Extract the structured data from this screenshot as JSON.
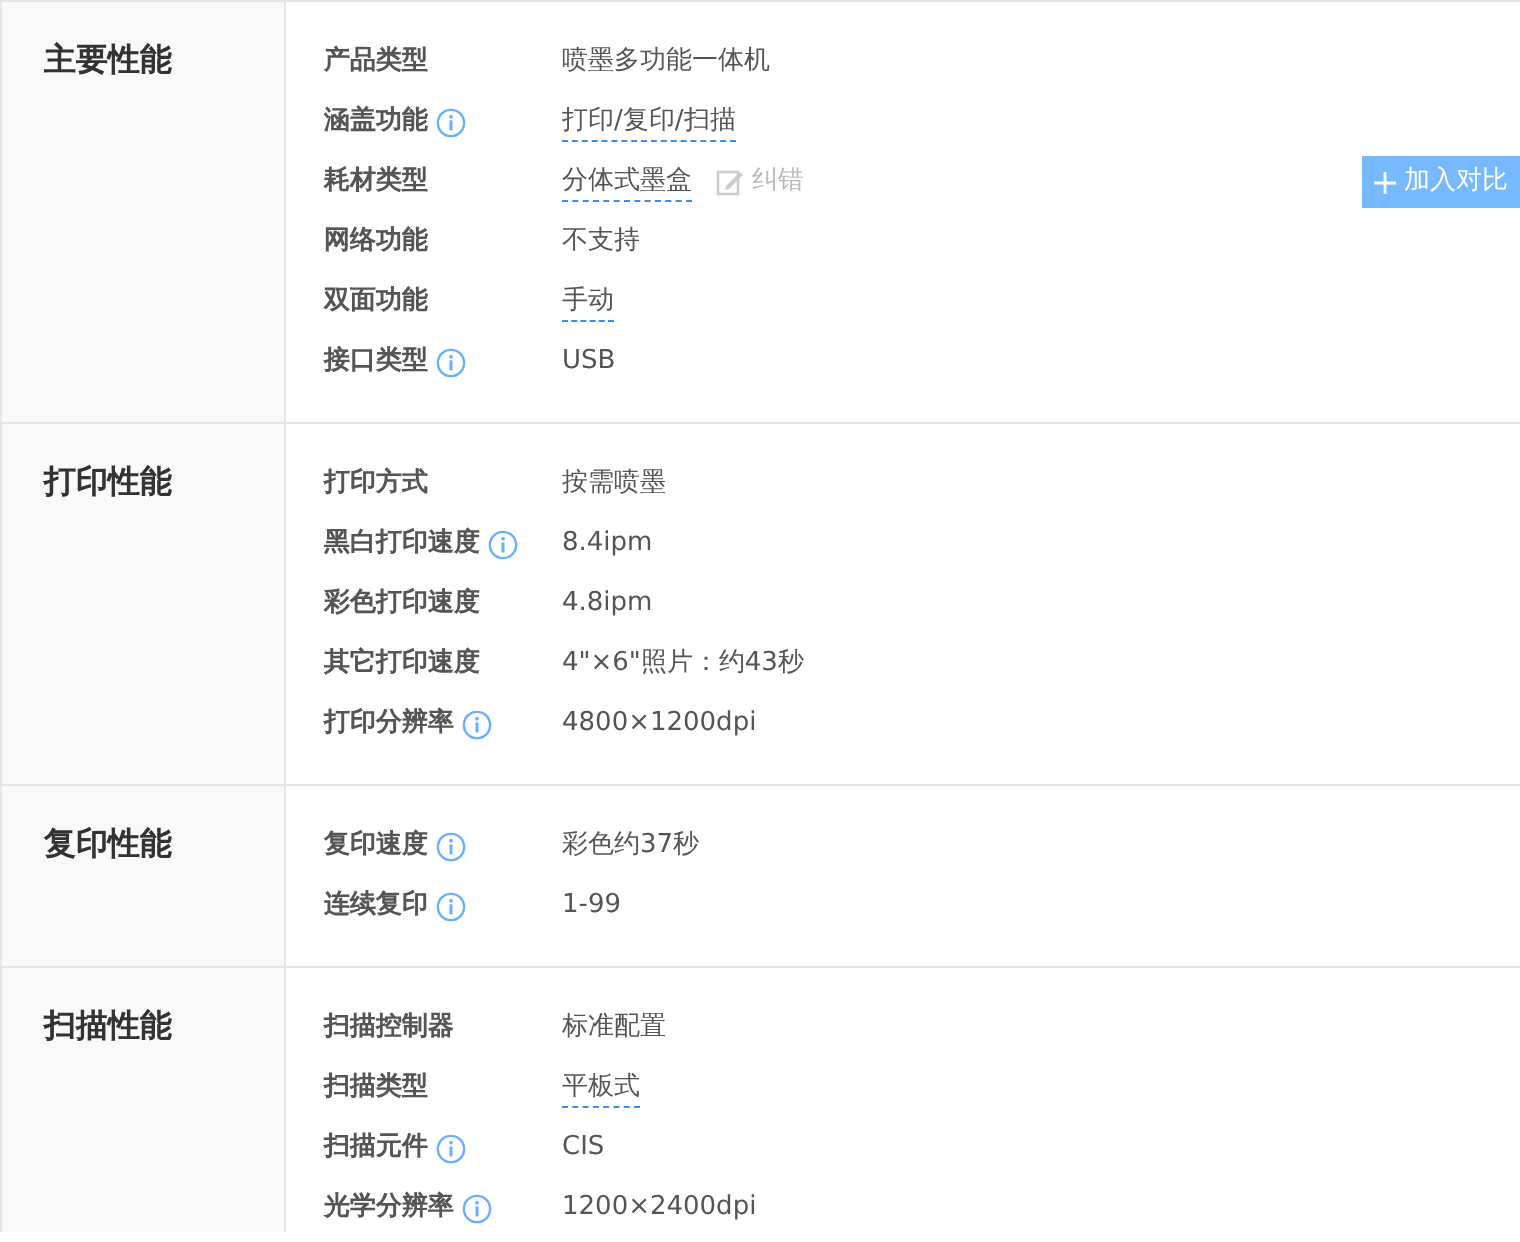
{
  "sections": [
    {
      "title": "主要性能",
      "rows": [
        {
          "label": "产品类型",
          "info": false,
          "value": "喷墨多功能一体机",
          "underlined": false
        },
        {
          "label": "涵盖功能",
          "info": true,
          "value": "打印/复印/扫描",
          "underlined": true
        },
        {
          "label": "耗材类型",
          "info": false,
          "value": "分体式墨盒",
          "underlined": true,
          "correction": "纠错",
          "compare_button": "加入对比"
        },
        {
          "label": "网络功能",
          "info": false,
          "value": "不支持",
          "underlined": false
        },
        {
          "label": "双面功能",
          "info": false,
          "value": "手动",
          "underlined": true
        },
        {
          "label": "接口类型",
          "info": true,
          "value": "USB",
          "underlined": false
        }
      ]
    },
    {
      "title": "打印性能",
      "rows": [
        {
          "label": "打印方式",
          "info": false,
          "value": "按需喷墨",
          "underlined": false
        },
        {
          "label": "黑白打印速度",
          "info": true,
          "value": "8.4ipm",
          "underlined": false
        },
        {
          "label": "彩色打印速度",
          "info": false,
          "value": "4.8ipm",
          "underlined": false
        },
        {
          "label": "其它打印速度",
          "info": false,
          "value": "4\"×6\"照片：约43秒",
          "underlined": false
        },
        {
          "label": "打印分辨率",
          "info": true,
          "value": "4800×1200dpi",
          "underlined": false
        }
      ]
    },
    {
      "title": "复印性能",
      "rows": [
        {
          "label": "复印速度",
          "info": true,
          "value": "彩色约37秒",
          "underlined": false
        },
        {
          "label": "连续复印",
          "info": true,
          "value": "1-99",
          "underlined": false
        }
      ]
    },
    {
      "title": "扫描性能",
      "rows": [
        {
          "label": "扫描控制器",
          "info": false,
          "value": "标准配置",
          "underlined": false
        },
        {
          "label": "扫描类型",
          "info": false,
          "value": "平板式",
          "underlined": true
        },
        {
          "label": "扫描元件",
          "info": true,
          "value": "CIS",
          "underlined": false
        },
        {
          "label": "光学分辨率",
          "info": true,
          "value": "1200×2400dpi",
          "underlined": false
        }
      ]
    }
  ]
}
